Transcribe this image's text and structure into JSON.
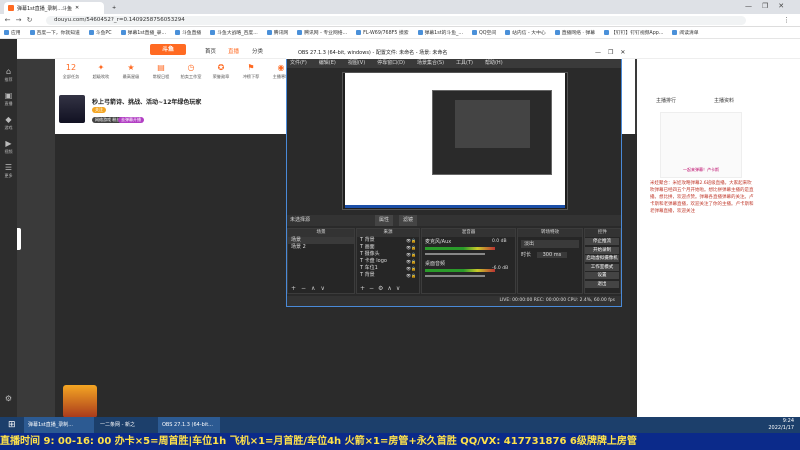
{
  "browser": {
    "tabs": [
      {
        "label": "弹幕1st直播_录制...斗鱼",
        "color": "#ff6a22"
      },
      {
        "label": "",
        "color": "#888"
      }
    ],
    "url": "douyu.com/5460452?_r=0.1409258756053294",
    "bookmarks": [
      "应用",
      "百度一下，你就知道",
      "斗鱼PC",
      "弹幕1st直播_录...",
      "斗鱼直播",
      "斗鱼大战略_百度...",
      "腾讯网",
      "腾讯网 - 专业网络...",
      "FL-W69/768F5 摸索",
      "弹幕1st的斗鱼_...",
      "QQ空间",
      "站内信 - 大中心",
      "直播网络 · 弹幕",
      "【钉钉】钉钉视频App...",
      "阅读清单"
    ]
  },
  "douyu": {
    "logo": "斗鱼",
    "nav": [
      "首页",
      "直播",
      "分类",
      "游戏",
      "鱼吧"
    ],
    "header_items": [
      {
        "label": "12",
        "sub": "全部任务"
      },
      {
        "label": "超级吹吹",
        "sub": ""
      },
      {
        "label": "最高星级",
        "sub": ""
      },
      {
        "label": "常规日程",
        "sub": ""
      },
      {
        "label": "拍卖工作室",
        "sub": ""
      },
      {
        "label": "荣誉勋章",
        "sub": ""
      },
      {
        "label": "冲榜下荐",
        "sub": ""
      },
      {
        "label": "主播寒城",
        "sub": ""
      },
      {
        "label": "表情包",
        "sub": ""
      },
      {
        "label": "开播日记",
        "sub": ""
      }
    ],
    "room_title": "秒上弓箭诗、挑战、活动~12年绿色玩家",
    "room_category": "斗鱼",
    "badges": [
      "关注",
      "网络游戏 粉丝",
      "去弹幕开播"
    ],
    "follow_btn": "PC客户端",
    "right_tabs": [
      "主播排行",
      "主播资料"
    ],
    "right_note": "米娃聚合：米娃攻略弹幕2.6班级直播。大家起来吹吹弹幕已经四五个月开始啦。想比拼弹幕主播的是直播。想比拼，欢迎点赞。弹幕各直播弹幕的关注。卢卡斯和老弹幕直播，欢迎关注了你的主播。卢卡斯和老弹幕直播，欢迎关注",
    "right_caption": "一起来弹幕！卢卡斯"
  },
  "obs": {
    "title": "OBS 27.1.3 (64-bit, windows) - 配置文件: 未命名 - 场景: 未命名",
    "menu": [
      "文件(F)",
      "编辑(E)",
      "视图(V)",
      "停靠窗口(D)",
      "场景集合(S)",
      "工具(T)",
      "帮助(H)"
    ],
    "source_hint": "未选择源",
    "source_buttons": [
      "属性",
      "滤镜"
    ],
    "panels": {
      "scenes": {
        "title": "场景",
        "items": [
          "场景",
          "场景 2"
        ]
      },
      "sources": {
        "title": "来源",
        "items": [
          "背景",
          "画面",
          "摄像头",
          "卡盘 logo",
          "车位1",
          "背景"
        ]
      },
      "mixer": {
        "title": "混音器",
        "tracks": [
          {
            "name": "麦克风/Aux",
            "db": "0.0 dB"
          },
          {
            "name": "桌面音频",
            "db": "-6.0 dB"
          }
        ]
      },
      "transitions": {
        "title": "转场特效",
        "type": "淡出",
        "duration_label": "时长",
        "duration": "300 ms"
      },
      "controls": {
        "title": "控件",
        "buttons": [
          "停止推流",
          "开始录制",
          "启动虚拟摄像机",
          "工作室模式",
          "设置",
          "退出"
        ]
      }
    },
    "status": "LIVE: 00:00:00   REC: 00:00:00   CPU: 2.4%, 60.00 fps"
  },
  "taskbar": {
    "apps": [
      "弹幕1st直播_录制...",
      "一二条网 - 新之",
      "OBS 27.1.3 (64-bit..."
    ],
    "time": "9:24",
    "date": "2022/1/17"
  },
  "ticker": {
    "text": "直播时间 9: 00-16: 00  办卡×5=周首胜|车位1h  飞机×1=月首胜/车位4h  火箭×1=房管+永久首胜  QQ/VX: 417731876  6级牌牌上房管"
  }
}
